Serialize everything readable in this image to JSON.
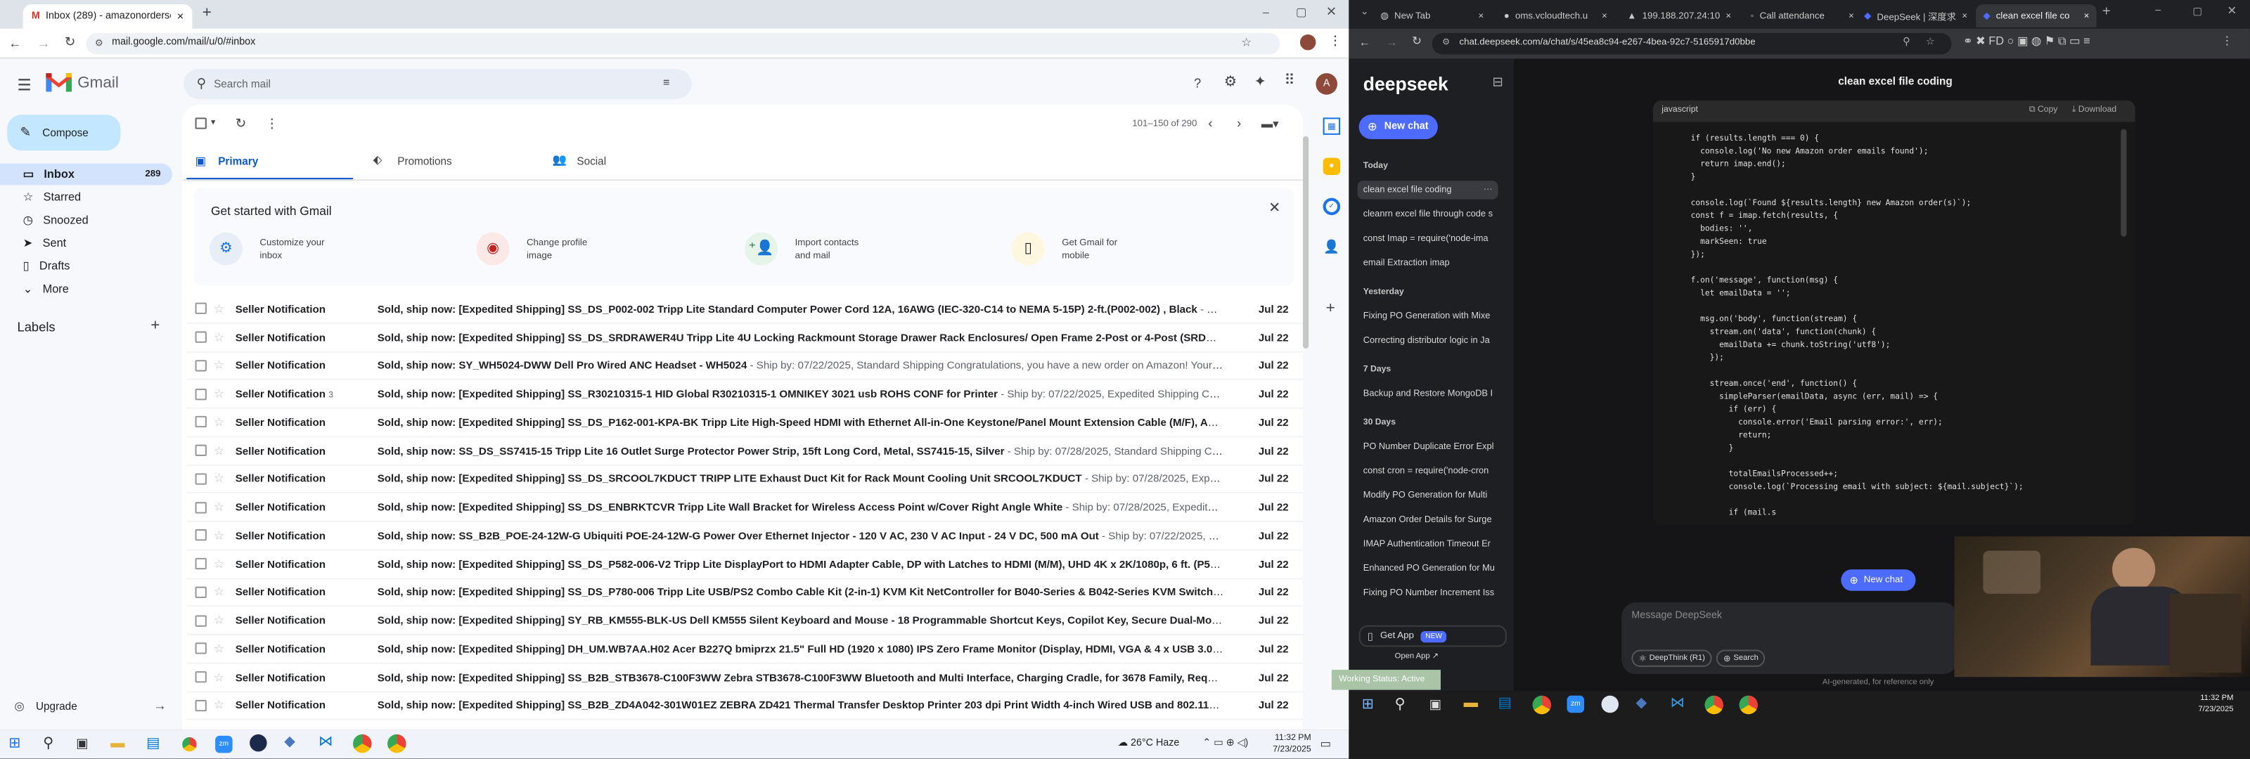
{
  "gmail": {
    "tab_title": "Inbox (289) - amazonordersch",
    "url": "mail.google.com/mail/u/0/#inbox",
    "logo": "Gmail",
    "search_placeholder": "Search mail",
    "compose": "Compose",
    "nav": [
      {
        "label": "Inbox",
        "count": "289",
        "icon": "inbox-icon"
      },
      {
        "label": "Starred",
        "count": "",
        "icon": "star-icon"
      },
      {
        "label": "Snoozed",
        "count": "",
        "icon": "clock-icon"
      },
      {
        "label": "Sent",
        "count": "",
        "icon": "send-icon"
      },
      {
        "label": "Drafts",
        "count": "",
        "icon": "draft-icon"
      },
      {
        "label": "More",
        "count": "",
        "icon": "chevron-down-icon"
      }
    ],
    "labels_heading": "Labels",
    "upgrade": "Upgrade",
    "pager": "101–150 of 290",
    "tabs": [
      "Primary",
      "Promotions",
      "Social"
    ],
    "get_started": {
      "title": "Get started with Gmail",
      "cards": [
        {
          "line1": "Customize your",
          "line2": "inbox"
        },
        {
          "line1": "Change profile",
          "line2": "image"
        },
        {
          "line1": "Import contacts",
          "line2": "and mail"
        },
        {
          "line1": "Get Gmail for",
          "line2": "mobile"
        }
      ]
    },
    "rows": [
      {
        "sender": "Seller Notification",
        "count": "",
        "subject": "Sold, ship now: [Expedited Shipping] SS_DS_P002-002 Tripp Lite Standard Computer Power Cord 12A, 16AWG (IEC-320-C14 to NEMA 5-15P) 2-ft.(P002-002) , Black",
        "snippet": " - Ship by:...",
        "date": "Jul 22"
      },
      {
        "sender": "Seller Notification",
        "count": "",
        "subject": "Sold, ship now: [Expedited Shipping] SS_DS_SRDRAWER4U Tripp Lite 4U Locking Rackmount Storage Drawer Rack Enclosures/ Open Frame 2-Post or 4-Post (SRDRAWER4U),...",
        "snippet": "",
        "date": "Jul 22"
      },
      {
        "sender": "Seller Notification",
        "count": "",
        "subject": "Sold, ship now: SY_WH5024-DWW Dell Pro Wired ANC Headset - WH5024",
        "snippet": " - Ship by: 07/22/2025, Standard Shipping Congratulations, you have a new order on Amazon! Your custome...",
        "date": "Jul 22"
      },
      {
        "sender": "Seller Notification",
        "count": "3",
        "subject": "Sold, ship now: [Expedited Shipping] SS_R30210315-1 HID Global R30210315-1 OMNIKEY 3021 usb ROHS CONF for Printer",
        "snippet": " - Ship by: 07/22/2025, Expedited Shipping Congratulati...",
        "date": "Jul 22"
      },
      {
        "sender": "Seller Notification",
        "count": "",
        "subject": "Sold, ship now: [Expedited Shipping] SS_DS_P162-001-KPA-BK Tripp Lite High-Speed HDMI with Ethernet All-in-One Keystone/Panel Mount Extension Cable (M/F), Angled C...",
        "snippet": "",
        "date": "Jul 22"
      },
      {
        "sender": "Seller Notification",
        "count": "",
        "subject": "Sold, ship now: SS_DS_SS7415-15 Tripp Lite 16 Outlet Surge Protector Power Strip, 15ft Long Cord, Metal, SS7415-15, Silver",
        "snippet": " - Ship by: 07/28/2025, Standard Shipping Congratulati...",
        "date": "Jul 22"
      },
      {
        "sender": "Seller Notification",
        "count": "",
        "subject": "Sold, ship now: [Expedited Shipping] SS_DS_SRCOOL7KDUCT TRIPP LITE Exhaust Duct Kit for Rack Mount Cooling Unit SRCOOL7KDUCT",
        "snippet": " - Ship by: 07/28/2025, Expedited Shipp...",
        "date": "Jul 22"
      },
      {
        "sender": "Seller Notification",
        "count": "",
        "subject": "Sold, ship now: [Expedited Shipping] SS_DS_ENBRKTCVR Tripp Lite Wall Bracket for Wireless Access Point w/Cover Right Angle White",
        "snippet": " - Ship by: 07/28/2025, Expedited Shipping ...",
        "date": "Jul 22"
      },
      {
        "sender": "Seller Notification",
        "count": "",
        "subject": "Sold, ship now: SS_B2B_POE-24-12W-G Ubiquiti POE-24-12W-G Power Over Ethernet Injector - 120 V AC, 230 V AC Input - 24 V DC, 500 mA Out",
        "snippet": " - Ship by: 07/22/2025, Standar...",
        "date": "Jul 22"
      },
      {
        "sender": "Seller Notification",
        "count": "",
        "subject": "Sold, ship now: [Expedited Shipping] SS_DS_P582-006-V2 Tripp Lite DisplayPort to HDMI Adapter Cable, DP with Latches to HDMI (M/M), UHD 4K x 2K/1080p, 6 ft. (P582-006...",
        "snippet": "",
        "date": "Jul 22"
      },
      {
        "sender": "Seller Notification",
        "count": "",
        "subject": "Sold, ship now: [Expedited Shipping] SS_DS_P780-006 Tripp Lite USB/PS2 Combo Cable Kit (2-in-1) KVM Kit NetController for B040-Series & B042-Series KVM Switches, 6 Fo...",
        "snippet": "",
        "date": "Jul 22"
      },
      {
        "sender": "Seller Notification",
        "count": "",
        "subject": "Sold, ship now: [Expedited Shipping] SY_RB_KM555-BLK-US Dell KM555 Silent Keyboard and Mouse - 18 Programmable Shortcut Keys, Copilot Key, Secure Dual-Mode conne...",
        "snippet": "",
        "date": "Jul 22"
      },
      {
        "sender": "Seller Notification",
        "count": "",
        "subject": "Sold, ship now: [Expedited Shipping] DH_UM.WB7AA.H02 Acer B227Q bmiprzx 21.5\" Full HD (1920 x 1080) IPS Zero Frame Monitor (Display, HDMI, VGA & 4 x USB 3.0 Ports)",
        "snippet": " - S...",
        "date": "Jul 22"
      },
      {
        "sender": "Seller Notification",
        "count": "",
        "subject": "Sold, ship now: [Expedited Shipping] SS_B2B_STB3678-C100F3WW Zebra STB3678-C100F3WW Bluetooth and Multi Interface, Charging Cradle, for 3678 Family, Requires: PW...",
        "snippet": "",
        "date": "Jul 22"
      },
      {
        "sender": "Seller Notification",
        "count": "",
        "subject": "Sold, ship now: [Expedited Shipping] SS_B2B_ZD4A042-301W01EZ ZEBRA ZD421 Thermal Transfer Desktop Printer 203 dpi Print Width 4-inch Wired USB and 802.11ac Conne...",
        "snippet": "",
        "date": "Jul 22"
      }
    ]
  },
  "taskbar_left": {
    "weather": "26°C  Haze",
    "time": "11:32 PM",
    "date": "7/23/2025"
  },
  "right": {
    "tabs": [
      "New Tab",
      "oms.vcloudtech.u",
      "199.188.207.24:10",
      "Call attendance",
      "DeepSeek | 深度求",
      "clean excel file co"
    ],
    "url": "chat.deepseek.com/a/chat/s/45ea8c94-e267-4bea-92c7-5165917d0bbe",
    "logo": "deepseek",
    "new_chat": "New chat",
    "chat_title": "clean excel file coding",
    "groups": [
      {
        "heading": "Today",
        "items": [
          "clean excel file coding",
          "cleanrn excel file through code s",
          "const Imap = require('node-ima",
          "email Extraction imap"
        ]
      },
      {
        "heading": "Yesterday",
        "items": [
          "Fixing PO Generation with Mixe",
          "Correcting distributor logic in Ja"
        ]
      },
      {
        "heading": "7 Days",
        "items": [
          "Backup and Restore MongoDB I"
        ]
      },
      {
        "heading": "30 Days",
        "items": [
          "PO Number Duplicate Error Expl",
          "const cron = require('node-cron",
          "Modify PO Generation for Multi",
          "Amazon Order Details for Surge",
          "IMAP Authentication Timeout Er",
          "Enhanced PO Generation for Mu",
          "Fixing PO Number Increment Iss"
        ]
      }
    ],
    "get_app": "Get App",
    "new_badge": "NEW",
    "code_lang": "javascript",
    "copy": "Copy",
    "download": "Download",
    "code_lines": [
      "    if (results.length === 0) {",
      "      console.log('No new Amazon order emails found');",
      "      return imap.end();",
      "    }",
      "",
      "    console.log(`Found ${results.length} new Amazon order(s)`);",
      "    const f = imap.fetch(results, {",
      "      bodies: '',",
      "      markSeen: true",
      "    });",
      "",
      "    f.on('message', function(msg) {",
      "      let emailData = '';",
      "",
      "      msg.on('body', function(stream) {",
      "        stream.on('data', function(chunk) {",
      "          emailData += chunk.toString('utf8');",
      "        });",
      "",
      "        stream.once('end', function() {",
      "          simpleParser(emailData, async (err, mail) => {",
      "            if (err) {",
      "              console.error('Email parsing error:', err);",
      "              return;",
      "            }",
      "",
      "            totalEmailsProcessed++;",
      "            console.log(`Processing email with subject: ${mail.subject}`);",
      "",
      "            if (mail.s"
    ],
    "new_chat_float": "New chat",
    "input_placeholder": "Message DeepSeek",
    "deepthink": "DeepThink (R1)",
    "search": "Search",
    "disclaimer": "AI-generated, for reference only",
    "open_app": "Open App ↗",
    "status": "Working Status: Active",
    "time": "11:32 PM",
    "date": "7/23/2025"
  }
}
